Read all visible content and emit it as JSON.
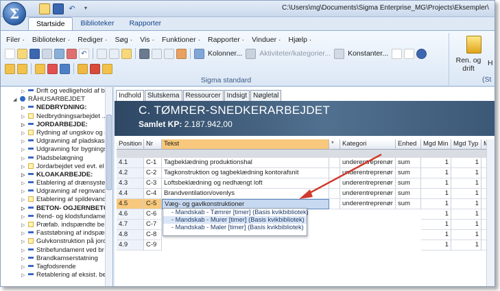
{
  "window": {
    "title": "C:\\Users\\mg\\Documents\\Sigma Enterprise_MG\\Projects\\Eksempler\\",
    "app_letter": "Σ"
  },
  "ribbon": {
    "tabs": [
      "Startside",
      "Biblioteker",
      "Rapporter"
    ],
    "menus": [
      "Filer ·",
      "Biblioteker ·",
      "Rediger ·",
      "Søg ·",
      "Vis ·",
      "Funktioner ·",
      "Rapporter ·",
      "Vinduer ·",
      "Hjælp ·"
    ],
    "kolonner": "Kolonner...",
    "aktiviteter": "Aktiviteter/kategorier...",
    "konstanter": "Konstanter...",
    "group_label": "Sigma standard",
    "ren_label": "Ren. og drift",
    "h_label": "H",
    "st_label": "(St"
  },
  "tree": {
    "items": [
      {
        "text": "Drift og vedligehold af b",
        "icon": "dash",
        "bold": false,
        "indent": 2
      },
      {
        "text": "RÅHUSARBEJDET",
        "icon": "dot",
        "bold": false,
        "indent": 1
      },
      {
        "text": "NEDBRYDNING:",
        "icon": "dash",
        "bold": true,
        "indent": 2
      },
      {
        "text": "Nedbrydningsarbejdet ..",
        "icon": "doc",
        "bold": false,
        "indent": 2
      },
      {
        "text": "JORDARBEJDE:",
        "icon": "dash",
        "bold": true,
        "indent": 2
      },
      {
        "text": "Rydning af ungskov og r",
        "icon": "doc",
        "bold": false,
        "indent": 2
      },
      {
        "text": "Udgravning af pladskass",
        "icon": "dash",
        "bold": false,
        "indent": 2
      },
      {
        "text": "Udgravning for bygnings",
        "icon": "dash",
        "bold": false,
        "indent": 2
      },
      {
        "text": "Pladsbelægning",
        "icon": "dash",
        "bold": false,
        "indent": 2
      },
      {
        "text": "Jordarbejdet ved evt. el",
        "icon": "doc",
        "bold": false,
        "indent": 2
      },
      {
        "text": "KLOAKARBEJDE:",
        "icon": "dash",
        "bold": true,
        "indent": 2
      },
      {
        "text": "Etablering af drænsyste",
        "icon": "dash",
        "bold": false,
        "indent": 2
      },
      {
        "text": "Udgravning af regnvands",
        "icon": "dash",
        "bold": false,
        "indent": 2
      },
      {
        "text": "Etablering af spildevand",
        "icon": "doc",
        "bold": false,
        "indent": 2
      },
      {
        "text": "BETON- OGJERNBETON",
        "icon": "dash",
        "bold": true,
        "indent": 2
      },
      {
        "text": "Rend- og klodsfundame",
        "icon": "dash",
        "bold": false,
        "indent": 2
      },
      {
        "text": "Præfab. indspændte be",
        "icon": "doc",
        "bold": false,
        "indent": 2
      },
      {
        "text": "Faststøbning af indspær",
        "icon": "dash",
        "bold": false,
        "indent": 2
      },
      {
        "text": "Gulvkonstruktion på jord",
        "icon": "doc",
        "bold": false,
        "indent": 2
      },
      {
        "text": "Stribefundament ved br",
        "icon": "dash",
        "bold": false,
        "indent": 2
      },
      {
        "text": "Brandkamserstatning",
        "icon": "dash",
        "bold": false,
        "indent": 2
      },
      {
        "text": "Tagfodsrende",
        "icon": "dash",
        "bold": false,
        "indent": 2
      },
      {
        "text": "Retablering af eksist. be",
        "icon": "dash",
        "bold": false,
        "indent": 2
      }
    ]
  },
  "content": {
    "tabs": [
      "Indhold",
      "Slutskema",
      "Ressourcer",
      "Indsigt",
      "Nøgletal"
    ],
    "title": "C. TØMRER-SNEDKERARBEJDET",
    "subtitle_label": "Samlet KP:",
    "subtitle_value": "2.187.942,00"
  },
  "grid": {
    "headers": [
      "Position",
      "Nr",
      "Tekst",
      "*",
      "Kategori",
      "Enhed",
      "Mgd Min",
      "Mgd Typ",
      "Mgd"
    ],
    "rows": [
      {
        "pos": "4.1",
        "nr": "C-1",
        "tekst": "Tagbeklædning produktionshal",
        "kategori": "underentreprenør",
        "enhed": "sum",
        "min": "1",
        "typ": "1"
      },
      {
        "pos": "4.2",
        "nr": "C-2",
        "tekst": "Tagkonstruktion og tagbeklædning kontorafsnit",
        "kategori": "underentreprenør",
        "enhed": "sum",
        "min": "1",
        "typ": "1"
      },
      {
        "pos": "4.3",
        "nr": "C-3",
        "tekst": "Loftsbeklædning og nedhængt loft",
        "kategori": "underentreprenør",
        "enhed": "sum",
        "min": "1",
        "typ": "1"
      },
      {
        "pos": "4.4",
        "nr": "C-4",
        "tekst": "Brandventilation/ovenlys",
        "kategori": "underentreprenør",
        "enhed": "sum",
        "min": "1",
        "typ": "1"
      },
      {
        "pos": "4.5",
        "nr": "C-5",
        "tekst": "Væg- og gavlkonstruktioner",
        "kategori": "underentreprenør",
        "enhed": "sum",
        "min": "1",
        "typ": "1"
      },
      {
        "pos": "4.6",
        "nr": "C-6",
        "tekst": "",
        "kategori": "",
        "enhed": "",
        "min": "1",
        "typ": "1"
      },
      {
        "pos": "4.7",
        "nr": "C-7",
        "tekst": "",
        "kategori": "",
        "enhed": "",
        "min": "1",
        "typ": "1"
      },
      {
        "pos": "4.8",
        "nr": "C-8",
        "tekst": "",
        "kategori": "",
        "enhed": "",
        "min": "1",
        "typ": "1"
      },
      {
        "pos": "4.9",
        "nr": "C-9",
        "tekst": "",
        "kategori": "",
        "enhed": "",
        "min": "1",
        "typ": "1"
      }
    ],
    "selected_row": 4
  },
  "popup": {
    "items": [
      "- Mandskab - Tømrer [timer] (Basis kvikbibliotek)",
      "- Mandskab - Murer [timer] (Basis kvikbibliotek)",
      "- Mandskab - Maler [timer] (Basis kvikbibliotek)"
    ]
  },
  "colors": {
    "accent_red": "#d03a2e",
    "selection_orange": "#f8c87c",
    "banner_blue": "#3c5877"
  }
}
